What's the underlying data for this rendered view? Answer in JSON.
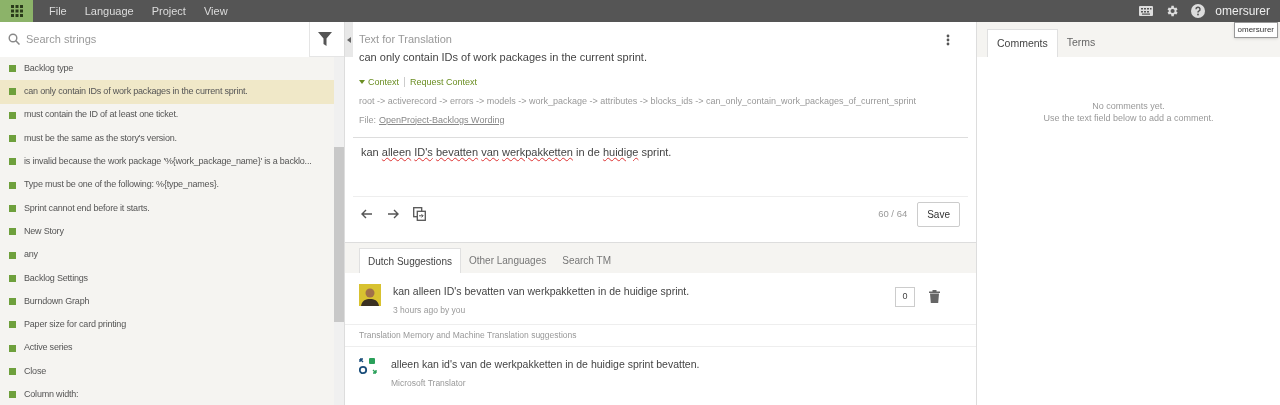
{
  "menu": [
    "File",
    "Language",
    "Project",
    "View"
  ],
  "user": {
    "name": "omersurer",
    "tooltip": "omersurer"
  },
  "search": {
    "placeholder": "Search strings"
  },
  "strings": [
    {
      "text": "Backlog type",
      "selected": false
    },
    {
      "text": "can only contain IDs of work packages in the current sprint.",
      "selected": true
    },
    {
      "text": "must contain the ID of at least one ticket.",
      "selected": false
    },
    {
      "text": "must be the same as the story's version.",
      "selected": false
    },
    {
      "text": "is invalid because the work package '%{work_package_name}' is a backlo...",
      "selected": false
    },
    {
      "text": "Type must be one of the following: %{type_names}.",
      "selected": false
    },
    {
      "text": "Sprint cannot end before it starts.",
      "selected": false
    },
    {
      "text": "New Story",
      "selected": false
    },
    {
      "text": "any",
      "selected": false
    },
    {
      "text": "Backlog Settings",
      "selected": false
    },
    {
      "text": "Burndown Graph",
      "selected": false
    },
    {
      "text": "Paper size for card printing",
      "selected": false
    },
    {
      "text": "Active series",
      "selected": false
    },
    {
      "text": "Close",
      "selected": false
    },
    {
      "text": "Column width:",
      "selected": false
    }
  ],
  "source": {
    "heading": "Text for Translation",
    "text": "can only contain IDs of work packages in the current sprint.",
    "context_label": "Context",
    "request_context": "Request Context",
    "path": "root -> activerecord -> errors -> models -> work_package -> attributes -> blocks_ids -> can_only_contain_work_packages_of_current_sprint",
    "file_label": "File:",
    "file_link": "OpenProject-Backlogs Wording"
  },
  "translation": {
    "segments": [
      {
        "text": "kan",
        "misspelled": false
      },
      {
        "text": "alleen",
        "misspelled": true
      },
      {
        "text": "ID's",
        "misspelled": true
      },
      {
        "text": "bevatten",
        "misspelled": true
      },
      {
        "text": "van",
        "misspelled": true
      },
      {
        "text": "werkpakketten",
        "misspelled": true
      },
      {
        "text": "in",
        "misspelled": false
      },
      {
        "text": "de",
        "misspelled": false
      },
      {
        "text": "huidige",
        "misspelled": true
      },
      {
        "text": "sprint.",
        "misspelled": false
      }
    ],
    "counter": "60 / 64",
    "save": "Save"
  },
  "suggestion_tabs": [
    {
      "label": "Dutch Suggestions",
      "selected": true
    },
    {
      "label": "Other Languages",
      "selected": false
    },
    {
      "label": "Search TM",
      "selected": false
    }
  ],
  "suggestion": {
    "text": "kan alleen ID's bevatten van werkpakketten in de huidige sprint.",
    "meta": "3 hours ago by you",
    "votes": "0"
  },
  "tm_heading": "Translation Memory and Machine Translation suggestions",
  "machine": {
    "text": "alleen kan id's van de werkpakketten in de huidige sprint bevatten.",
    "source": "Microsoft Translator"
  },
  "side_tabs": [
    {
      "label": "Comments",
      "selected": true
    },
    {
      "label": "Terms",
      "selected": false
    }
  ],
  "comments_empty": [
    "No comments yet.",
    "Use the text field below to add a comment."
  ]
}
